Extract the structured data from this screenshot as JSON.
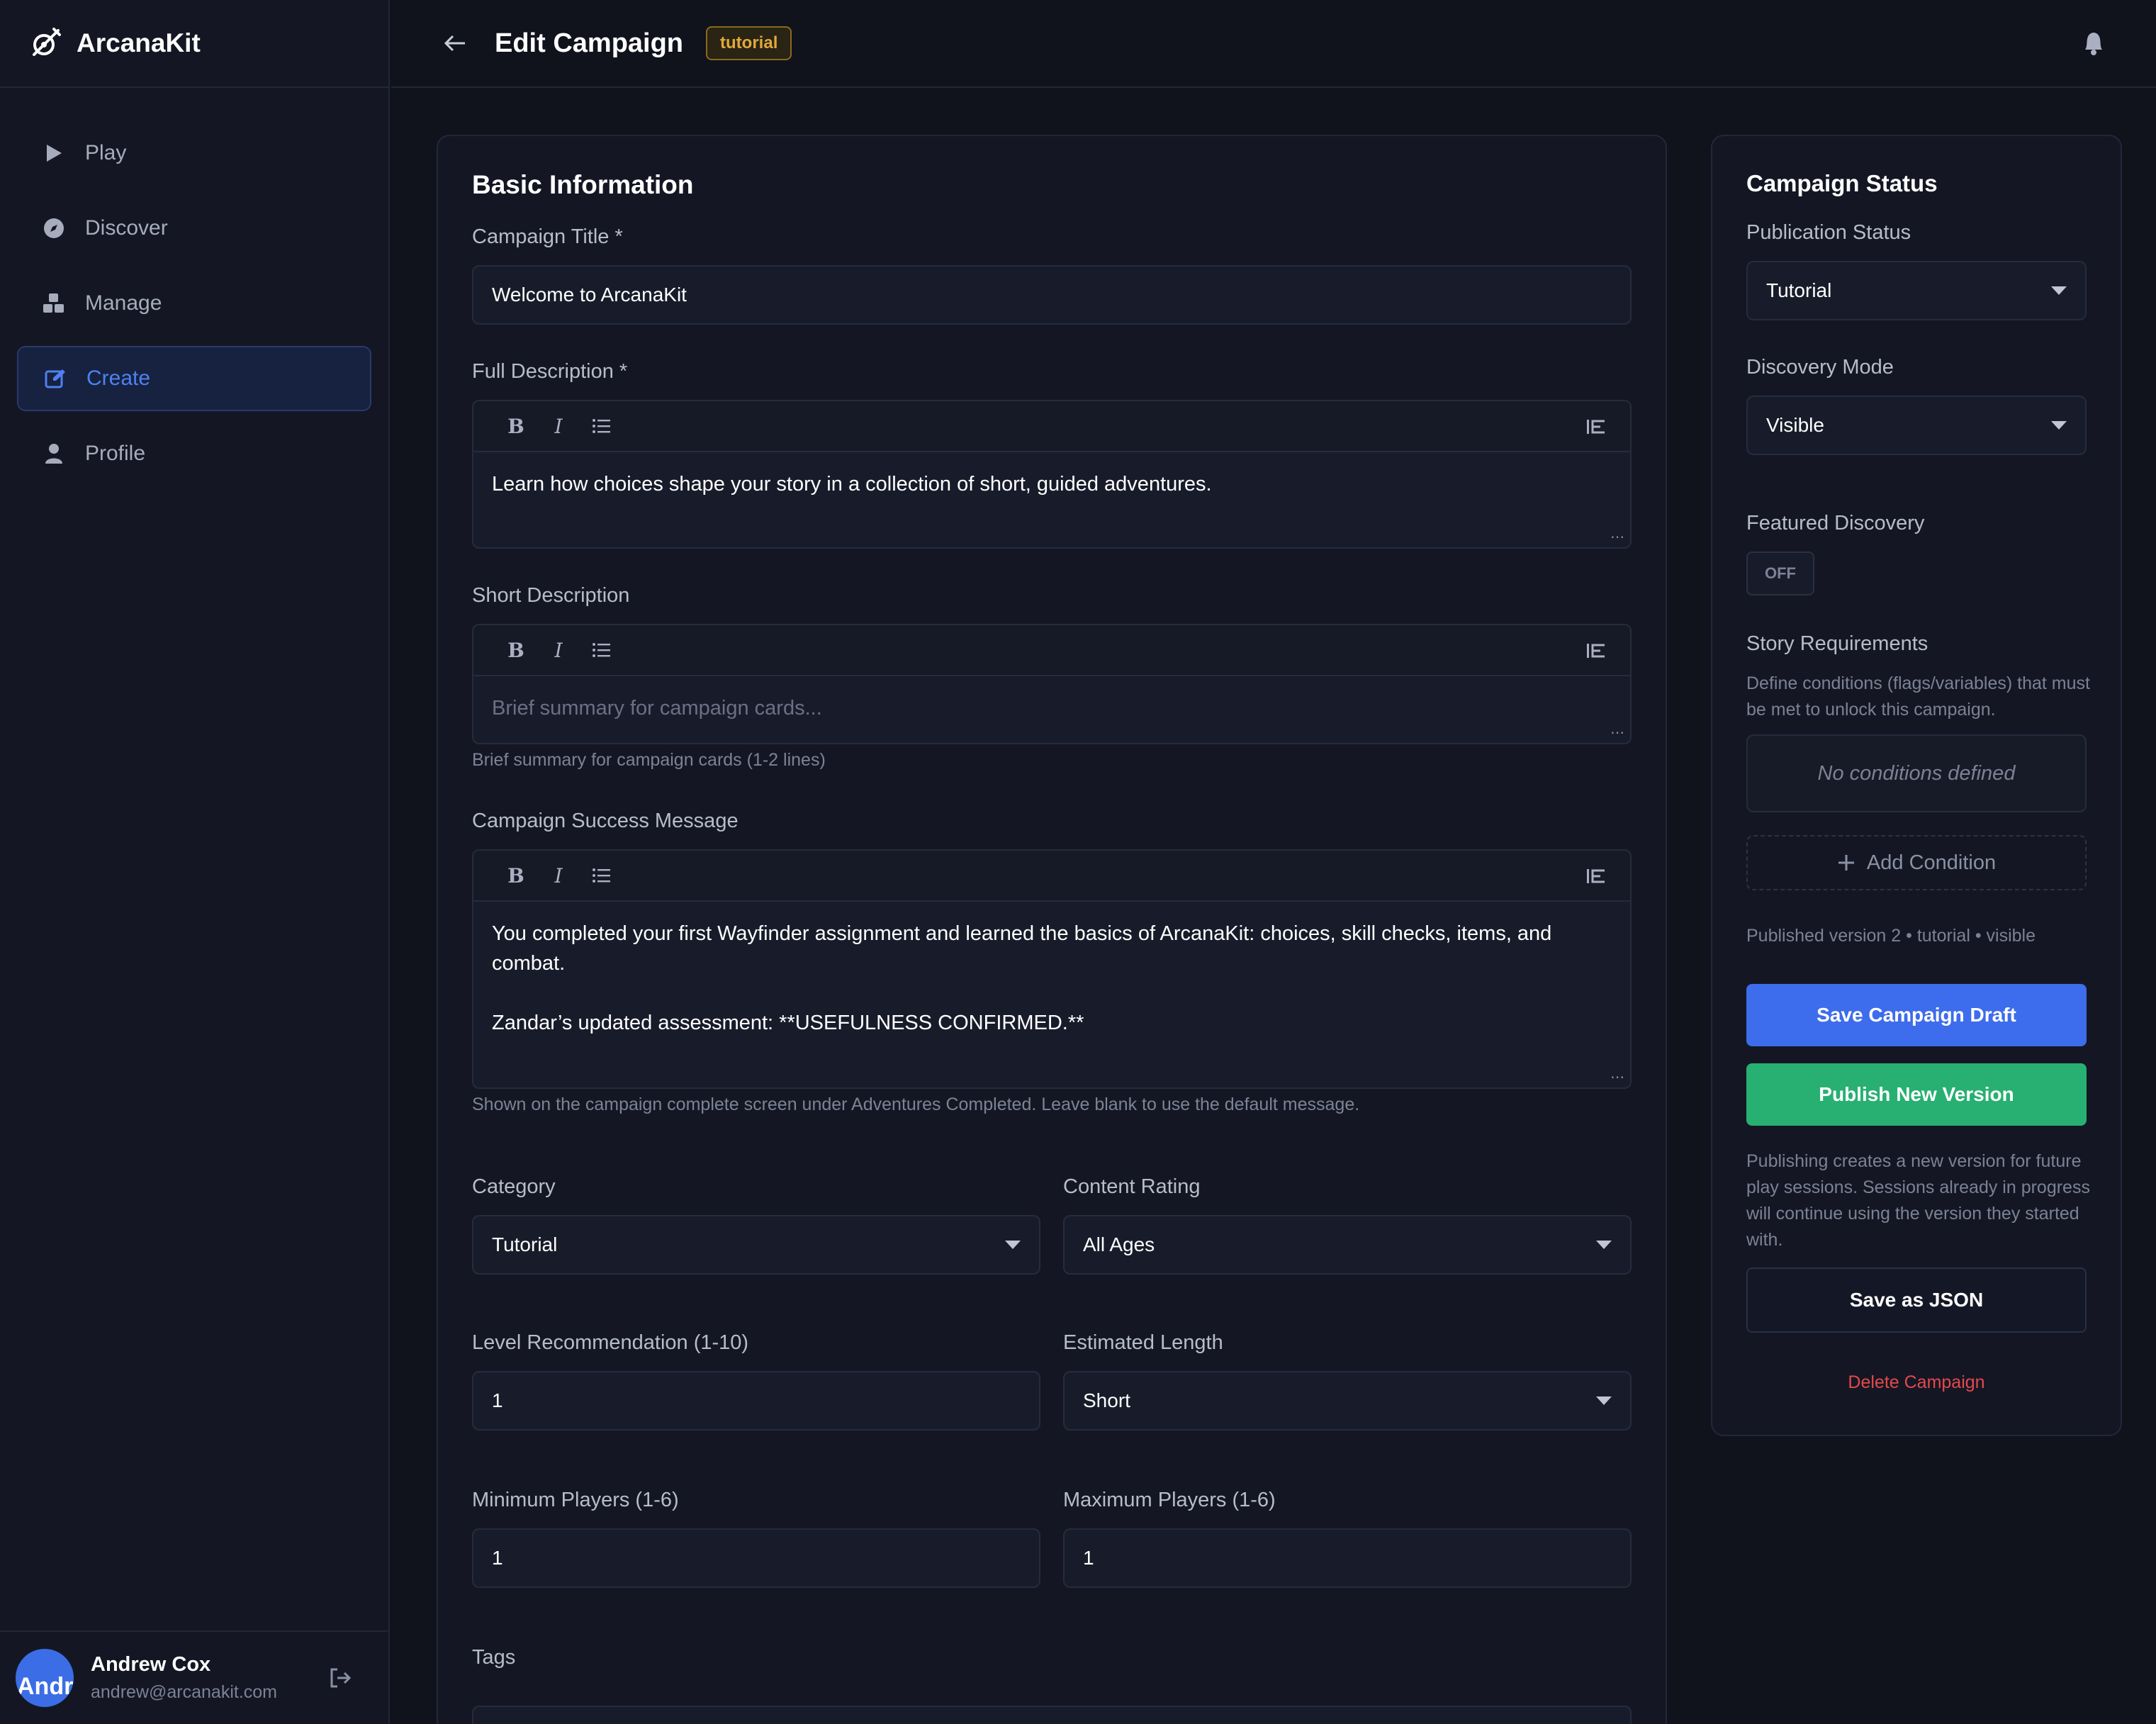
{
  "app": {
    "name": "ArcanaKit"
  },
  "nav": {
    "items": [
      {
        "label": "Play",
        "icon": "play-icon"
      },
      {
        "label": "Discover",
        "icon": "compass-icon"
      },
      {
        "label": "Manage",
        "icon": "cubes-icon"
      },
      {
        "label": "Create",
        "icon": "edit-icon",
        "active": true
      },
      {
        "label": "Profile",
        "icon": "user-icon"
      }
    ]
  },
  "user": {
    "avatar_text": "Andr",
    "name": "Andrew Cox",
    "email": "andrew@arcanakit.com"
  },
  "header": {
    "title": "Edit Campaign",
    "badge": "tutorial"
  },
  "basic": {
    "heading": "Basic Information",
    "title_label": "Campaign Title *",
    "title_value": "Welcome to ArcanaKit",
    "full_desc_label": "Full Description *",
    "full_desc_value": "Learn how choices shape your story in a collection of short, guided adventures.",
    "short_desc_label": "Short Description",
    "short_desc_placeholder": "Brief summary for campaign cards...",
    "short_desc_hint": "Brief summary for campaign cards (1-2 lines)",
    "success_label": "Campaign Success Message",
    "success_line1": "You completed your first Wayfinder assignment and learned the basics of ArcanaKit: choices, skill checks, items, and combat.",
    "success_line2": "Zandar’s updated assessment: **USEFULNESS CONFIRMED.**",
    "success_hint": "Shown on the campaign complete screen under Adventures Completed. Leave blank to use the default message.",
    "category_label": "Category",
    "category_value": "Tutorial",
    "rating_label": "Content Rating",
    "rating_value": "All Ages",
    "level_label": "Level Recommendation (1-10)",
    "level_value": "1",
    "length_label": "Estimated Length",
    "length_value": "Short",
    "min_players_label": "Minimum Players (1-6)",
    "min_players_value": "1",
    "max_players_label": "Maximum Players (1-6)",
    "max_players_value": "1",
    "tags_label": "Tags"
  },
  "status": {
    "heading": "Campaign Status",
    "publication_label": "Publication Status",
    "publication_value": "Tutorial",
    "discovery_label": "Discovery Mode",
    "discovery_value": "Visible",
    "featured_label": "Featured Discovery",
    "featured_toggle": "OFF",
    "requirements_label": "Story Requirements",
    "requirements_desc": "Define conditions (flags/variables) that must be met to unlock this campaign.",
    "no_conditions": "No conditions defined",
    "add_condition": "Add Condition",
    "version_info": "Published version 2 • tutorial • visible",
    "save_draft": "Save Campaign Draft",
    "publish": "Publish New Version",
    "publish_note": "Publishing creates a new version for future play sessions. Sessions already in progress will continue using the version they started with.",
    "save_json": "Save as JSON",
    "delete": "Delete Campaign"
  },
  "colors": {
    "accent": "#3d6cec",
    "success": "#27b072",
    "danger": "#e5484d",
    "badge": "#e0a93a"
  }
}
